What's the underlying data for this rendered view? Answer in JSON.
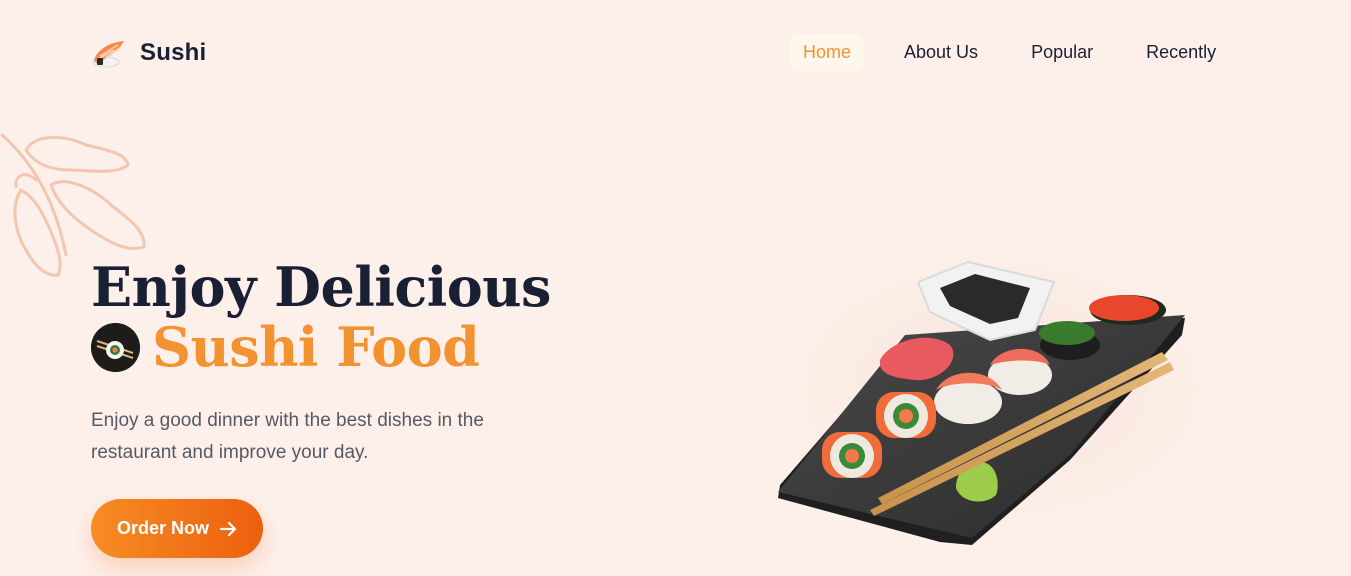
{
  "brand": {
    "name": "Sushi",
    "logo_icon": "sushi-logo-icon"
  },
  "nav": {
    "items": [
      {
        "label": "Home",
        "active": true
      },
      {
        "label": "About Us",
        "active": false
      },
      {
        "label": "Popular",
        "active": false
      },
      {
        "label": "Recently",
        "active": false
      }
    ]
  },
  "hero": {
    "title_line1": "Enjoy Delicious",
    "title_line2": "Sushi Food",
    "description": "Enjoy a good dinner with the best dishes in the restaurant and improve your day.",
    "cta_label": "Order Now",
    "cta_icon": "arrow-right-icon",
    "image_icon": "sushi-platter-image"
  },
  "colors": {
    "background": "#fdf0ea",
    "accent": "#f39230",
    "heading": "#1a2033",
    "body_text": "#565a63",
    "cta_start": "#f78c25",
    "cta_end": "#ec5f0e"
  }
}
